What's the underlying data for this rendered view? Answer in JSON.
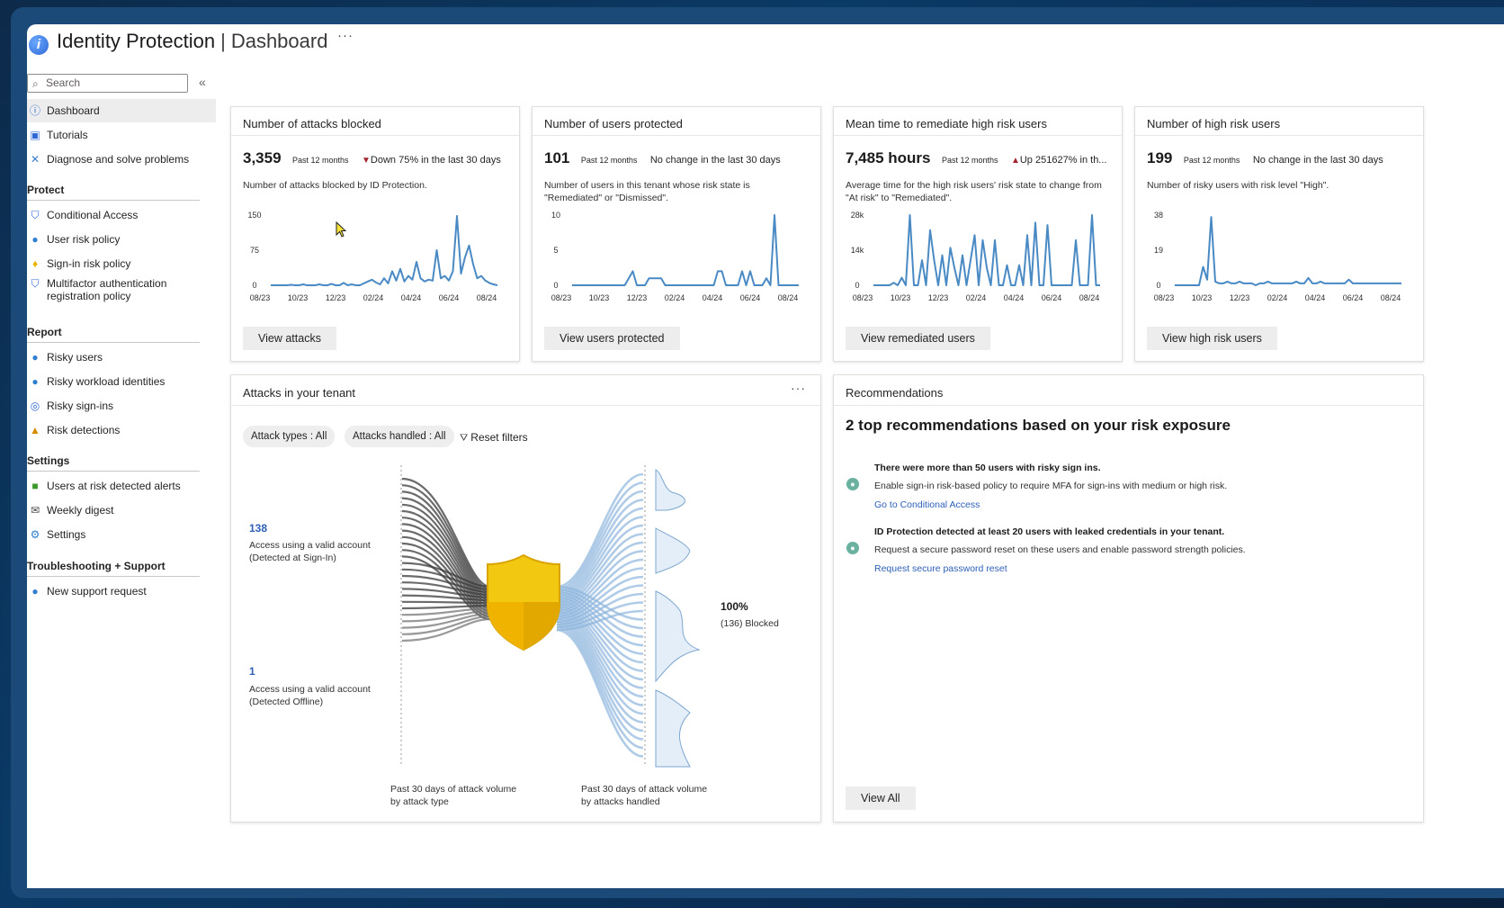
{
  "header": {
    "title": "Identity Protection",
    "subtitle": "Dashboard",
    "more": "···"
  },
  "sidebar": {
    "search_placeholder": "Search",
    "collapse": "«",
    "top": [
      {
        "label": "Dashboard",
        "icon": "info-icon"
      },
      {
        "label": "Tutorials",
        "icon": "book-icon"
      },
      {
        "label": "Diagnose and solve problems",
        "icon": "wrench-icon"
      }
    ],
    "sections": {
      "protect": "Protect",
      "report": "Report",
      "settings": "Settings",
      "troubleshooting": "Troubleshooting + Support"
    },
    "protect": [
      {
        "label": "Conditional Access",
        "icon": "shield-icon"
      },
      {
        "label": "User risk policy",
        "icon": "user-icon"
      },
      {
        "label": "Sign-in risk policy",
        "icon": "key-icon"
      },
      {
        "label": "Multifactor authentication",
        "label2": "registration policy",
        "icon": "shield-icon"
      }
    ],
    "report": [
      {
        "label": "Risky users",
        "icon": "users-icon"
      },
      {
        "label": "Risky workload identities",
        "icon": "users-icon"
      },
      {
        "label": "Risky sign-ins",
        "icon": "signin-icon"
      },
      {
        "label": "Risk detections",
        "icon": "warning-icon"
      }
    ],
    "settings": [
      {
        "label": "Users at risk detected alerts",
        "icon": "alert-icon"
      },
      {
        "label": "Weekly digest",
        "icon": "mail-icon"
      },
      {
        "label": "Settings",
        "icon": "gear-icon"
      }
    ],
    "troubleshooting": [
      {
        "label": "New support request",
        "icon": "support-icon"
      }
    ]
  },
  "cards": [
    {
      "title": "Number of attacks blocked",
      "value": "3,359",
      "period": "Past 12 months",
      "change_icon": "down",
      "change": "Down 75% in the last 30 days",
      "desc": "Number of attacks blocked by ID Protection.",
      "button": "View attacks"
    },
    {
      "title": "Number of users protected",
      "value": "101",
      "period": "Past 12 months",
      "change_icon": "",
      "change": "No change in the last 30 days",
      "desc": "Number of users in this tenant whose risk state is \"Remediated\" or \"Dismissed\".",
      "button": "View users protected"
    },
    {
      "title": "Mean time to remediate high risk users",
      "value": "7,485 hours",
      "period": "Past 12 months",
      "change_icon": "up",
      "change": "Up 251627% in th...",
      "desc": "Average time for the high risk users' risk state to change from \"At risk\" to \"Remediated\".",
      "button": "View remediated users"
    },
    {
      "title": "Number of high risk users",
      "value": "199",
      "period": "Past 12 months",
      "change_icon": "",
      "change": "No change in the last 30 days",
      "desc": "Number of risky users with risk level \"High\".",
      "button": "View high risk users"
    }
  ],
  "chart_data": [
    {
      "type": "line",
      "x": [
        "08/23",
        "10/23",
        "12/23",
        "02/24",
        "04/24",
        "06/24",
        "08/24"
      ],
      "y_ticks": [
        "150",
        "75",
        "0"
      ],
      "ylim": [
        0,
        150
      ],
      "values": [
        0,
        0,
        0,
        0,
        0,
        1,
        0,
        0,
        2,
        0,
        0,
        0,
        2,
        0,
        0,
        3,
        0,
        0,
        5,
        0,
        2,
        0,
        0,
        4,
        8,
        12,
        6,
        2,
        15,
        4,
        30,
        10,
        35,
        8,
        20,
        12,
        50,
        15,
        8,
        12,
        10,
        75,
        15,
        20,
        10,
        30,
        148,
        25,
        60,
        85,
        45,
        15,
        20,
        10,
        5,
        2,
        0
      ]
    },
    {
      "type": "line",
      "x": [
        "08/23",
        "10/23",
        "12/23",
        "02/24",
        "04/24",
        "06/24",
        "08/24"
      ],
      "y_ticks": [
        "10",
        "5",
        "0"
      ],
      "ylim": [
        0,
        10
      ],
      "values": [
        0,
        0,
        0,
        0,
        0,
        0,
        0,
        0,
        0,
        0,
        0,
        0,
        0,
        0,
        1,
        2,
        0,
        0,
        0,
        1,
        1,
        1,
        1,
        0,
        0,
        0,
        0,
        0,
        0,
        0,
        0,
        0,
        0,
        0,
        0,
        0,
        2,
        2,
        0,
        0,
        0,
        0,
        2,
        0,
        2,
        0,
        0,
        0,
        1,
        0,
        10,
        0,
        0,
        0,
        0,
        0,
        0
      ]
    },
    {
      "type": "line",
      "x": [
        "08/23",
        "10/23",
        "12/23",
        "02/24",
        "04/24",
        "06/24",
        "08/24"
      ],
      "y_ticks": [
        "28k",
        "14k",
        "0"
      ],
      "ylim": [
        0,
        28
      ],
      "values": [
        0,
        0,
        0,
        0,
        0,
        1,
        0,
        3,
        0,
        28,
        0,
        0,
        10,
        0,
        22,
        10,
        0,
        12,
        0,
        15,
        7,
        0,
        12,
        0,
        10,
        20,
        0,
        18,
        7,
        0,
        18,
        0,
        0,
        8,
        0,
        0,
        8,
        0,
        20,
        0,
        25,
        0,
        0,
        24,
        0,
        0,
        0,
        0,
        0,
        0,
        18,
        0,
        0,
        0,
        28,
        0,
        0
      ]
    },
    {
      "type": "line",
      "x": [
        "08/23",
        "10/23",
        "12/23",
        "02/24",
        "04/24",
        "06/24",
        "08/24"
      ],
      "y_ticks": [
        "38",
        "19",
        "0"
      ],
      "ylim": [
        0,
        38
      ],
      "values": [
        0,
        0,
        0,
        0,
        0,
        0,
        0,
        10,
        3,
        37,
        2,
        1,
        1,
        2,
        1,
        1,
        2,
        1,
        1,
        1,
        0,
        1,
        1,
        2,
        1,
        1,
        1,
        1,
        1,
        1,
        2,
        1,
        1,
        4,
        1,
        1,
        2,
        1,
        1,
        1,
        1,
        1,
        1,
        3,
        1,
        1,
        1,
        1,
        1,
        1,
        1,
        1,
        1,
        1,
        1,
        1,
        1
      ]
    }
  ],
  "attacks": {
    "title": "Attacks in your tenant",
    "more": "···",
    "filter1": "Attack types : All",
    "filter2": "Attacks handled : All",
    "reset": "Reset filters",
    "left1_value": "138",
    "left1_label1": "Access using a valid account",
    "left1_label2": "(Detected at Sign-In)",
    "left2_value": "1",
    "left2_label1": "Access using a valid account",
    "left2_label2": "(Detected Offline)",
    "right_value": "100%",
    "right_label": "(136) Blocked",
    "footer1_l1": "Past 30 days of attack volume",
    "footer1_l2": "by attack type",
    "footer2_l1": "Past 30 days of attack volume",
    "footer2_l2": "by attacks handled"
  },
  "recommendations": {
    "panel_title": "Recommendations",
    "title": "2 top recommendations based on your risk exposure",
    "items": [
      {
        "head": "There were more than 50 users with risky sign ins.",
        "body": "Enable sign-in risk-based policy to require MFA for sign-ins with medium or high risk.",
        "link": "Go to Conditional Access"
      },
      {
        "head": "ID Protection detected at least 20 users with leaked credentials in your tenant.",
        "body": "Request a secure password reset on these users and enable password strength policies.",
        "link": "Request secure password reset"
      }
    ],
    "button": "View All"
  },
  "colors": {
    "accent": "#2e5fb8",
    "line": "#4a8ac4",
    "shield": "#f2c811",
    "fan_dark": "#3a3a3a",
    "fan_light": "#8db5dd"
  }
}
